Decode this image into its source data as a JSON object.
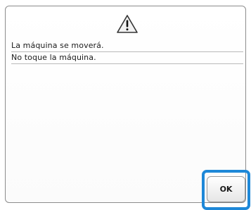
{
  "dialog": {
    "icon": "warning-icon",
    "lines": [
      "La máquina se moverá.",
      "No toque la máquina."
    ],
    "ok_label": "OK"
  },
  "colors": {
    "highlight": "#1e88d8",
    "dialog_border": "#8c8c8c",
    "rule_line": "#b9b9b9"
  }
}
